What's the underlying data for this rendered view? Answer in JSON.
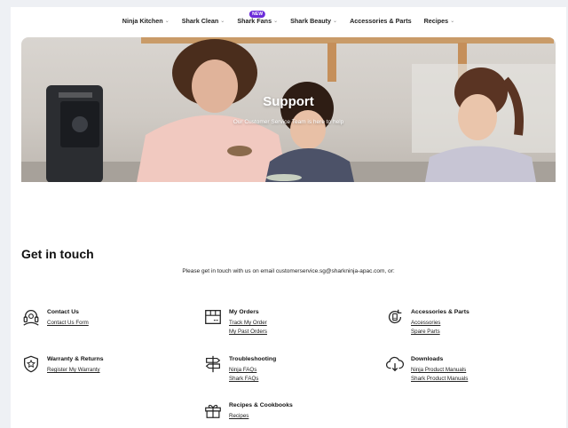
{
  "nav": {
    "items": [
      {
        "label": "Ninja Kitchen",
        "has_dropdown": true
      },
      {
        "label": "Shark Clean",
        "has_dropdown": true
      },
      {
        "label": "Shark Fans",
        "has_dropdown": true,
        "badge": "NEW"
      },
      {
        "label": "Shark Beauty",
        "has_dropdown": true
      },
      {
        "label": "Accessories & Parts",
        "has_dropdown": false
      },
      {
        "label": "Recipes",
        "has_dropdown": true
      }
    ]
  },
  "hero": {
    "title": "Support",
    "subtitle": "Our Customer Service Team is here to help",
    "appliance_brand": "NINJA"
  },
  "contact": {
    "title": "Get in touch",
    "intro": "Please get in touch with us on email customerservice.sg@sharkninja-apac.com, or:"
  },
  "cards": [
    {
      "title": "Contact Us",
      "icon": "headset-icon",
      "links": [
        "Contact Us Form"
      ]
    },
    {
      "title": "My Orders",
      "icon": "package-icon",
      "links": [
        "Track My Order",
        "My Past Orders"
      ]
    },
    {
      "title": "Accessories & Parts",
      "icon": "refresh-cycle-icon",
      "links": [
        "Accessories",
        "Spare Parts"
      ]
    },
    {
      "title": "Warranty & Returns",
      "icon": "shield-icon",
      "links": [
        "Register My Warranty"
      ]
    },
    {
      "title": "Troubleshooting",
      "icon": "signpost-icon",
      "links": [
        "Ninja FAQs",
        "Shark FAQs"
      ]
    },
    {
      "title": "Downloads",
      "icon": "cloud-download-icon",
      "links": [
        "Ninja Product Manuals",
        "Shark Product Manuals"
      ]
    },
    {
      "title": "Recipes & Cookbooks",
      "icon": "gift-icon",
      "links": [
        "Recipes"
      ]
    }
  ],
  "colors": {
    "badge": "#6b2bd9",
    "text": "#111111",
    "background": "#eef0f4"
  }
}
